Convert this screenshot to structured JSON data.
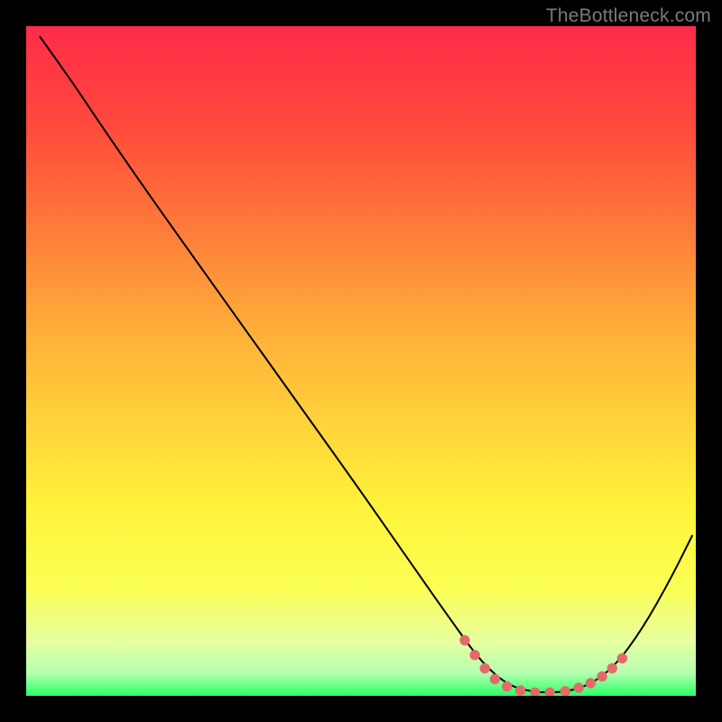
{
  "attribution": "TheBottleneck.com",
  "chart_data": {
    "type": "line",
    "title": "",
    "xlabel": "",
    "ylabel": "",
    "xlim": [
      0,
      100
    ],
    "ylim": [
      0,
      100
    ],
    "gradient_stops": [
      {
        "offset": 0.0,
        "color": "#ff2b49"
      },
      {
        "offset": 0.15,
        "color": "#ff4a3c"
      },
      {
        "offset": 0.3,
        "color": "#ff7a3a"
      },
      {
        "offset": 0.45,
        "color": "#ffad3a"
      },
      {
        "offset": 0.6,
        "color": "#ffd53a"
      },
      {
        "offset": 0.72,
        "color": "#fff33a"
      },
      {
        "offset": 0.84,
        "color": "#fbff55"
      },
      {
        "offset": 0.92,
        "color": "#e6ffa0"
      },
      {
        "offset": 0.965,
        "color": "#b7ffb0"
      },
      {
        "offset": 1.0,
        "color": "#2bff68"
      }
    ],
    "series": [
      {
        "name": "bottleneck-curve",
        "color": "#000000",
        "stroke_width": 2,
        "points": [
          {
            "x": 2.0,
            "y": 98.5
          },
          {
            "x": 7.0,
            "y": 91.5
          },
          {
            "x": 12.0,
            "y": 84.0
          },
          {
            "x": 20.0,
            "y": 72.5
          },
          {
            "x": 30.0,
            "y": 58.5
          },
          {
            "x": 40.0,
            "y": 44.5
          },
          {
            "x": 50.0,
            "y": 30.5
          },
          {
            "x": 58.0,
            "y": 19.0
          },
          {
            "x": 64.0,
            "y": 10.5
          },
          {
            "x": 68.0,
            "y": 5.0
          },
          {
            "x": 72.0,
            "y": 1.5
          },
          {
            "x": 76.0,
            "y": 0.5
          },
          {
            "x": 80.0,
            "y": 0.5
          },
          {
            "x": 84.0,
            "y": 1.5
          },
          {
            "x": 88.0,
            "y": 4.5
          },
          {
            "x": 92.0,
            "y": 10.0
          },
          {
            "x": 96.0,
            "y": 17.0
          },
          {
            "x": 99.5,
            "y": 24.0
          }
        ]
      },
      {
        "name": "optimal-markers",
        "color": "#e46a6a",
        "marker_radius": 5.7,
        "points": [
          {
            "x": 65.5,
            "y": 8.3
          },
          {
            "x": 67.0,
            "y": 6.1
          },
          {
            "x": 68.5,
            "y": 4.1
          },
          {
            "x": 70.0,
            "y": 2.5
          },
          {
            "x": 71.8,
            "y": 1.4
          },
          {
            "x": 73.8,
            "y": 0.8
          },
          {
            "x": 76.0,
            "y": 0.5
          },
          {
            "x": 78.2,
            "y": 0.5
          },
          {
            "x": 80.5,
            "y": 0.7
          },
          {
            "x": 82.5,
            "y": 1.2
          },
          {
            "x": 84.3,
            "y": 1.9
          },
          {
            "x": 86.0,
            "y": 2.9
          },
          {
            "x": 87.5,
            "y": 4.1
          },
          {
            "x": 89.0,
            "y": 5.6
          }
        ]
      }
    ]
  }
}
